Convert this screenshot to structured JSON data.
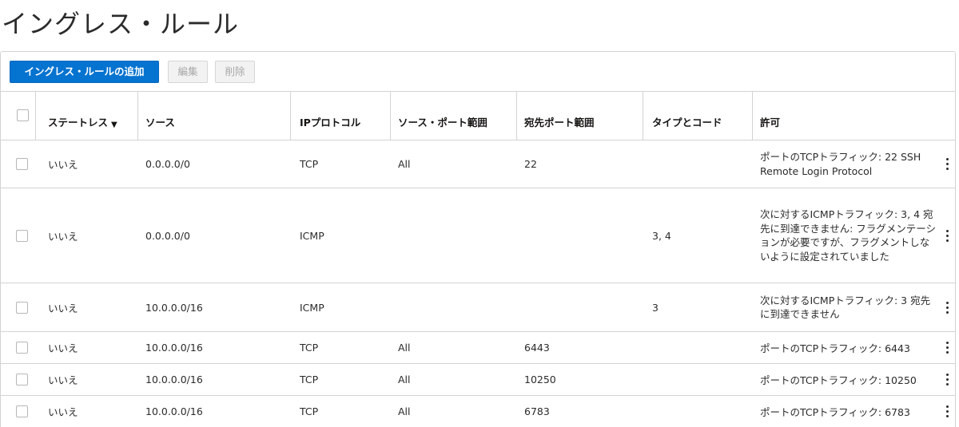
{
  "page": {
    "title": "イングレス・ルール"
  },
  "toolbar": {
    "add_label": "イングレス・ルールの追加",
    "edit_label": "編集",
    "delete_label": "削除"
  },
  "table": {
    "headers": {
      "stateless": "ステートレス",
      "stateless_sort": "▼",
      "source": "ソース",
      "protocol": "IPプロトコル",
      "source_port": "ソース・ポート範囲",
      "dest_port": "宛先ポート範囲",
      "type_code": "タイプとコード",
      "allows": "許可"
    },
    "rows": [
      {
        "stateless": "いいえ",
        "source": "0.0.0.0/0",
        "protocol": "TCP",
        "source_port": "All",
        "dest_port": "22",
        "type_code": "",
        "allows": "ポートのTCPトラフィック: 22 SSH Remote Login Protocol"
      },
      {
        "stateless": "いいえ",
        "source": "0.0.0.0/0",
        "protocol": "ICMP",
        "source_port": "",
        "dest_port": "",
        "type_code": "3, 4",
        "allows": "次に対するICMPトラフィック: 3, 4 宛先に到達できません: フラグメンテーションが必要ですが、フラグメントしないように設定されていました"
      },
      {
        "stateless": "いいえ",
        "source": "10.0.0.0/16",
        "protocol": "ICMP",
        "source_port": "",
        "dest_port": "",
        "type_code": "3",
        "allows": "次に対するICMPトラフィック: 3 宛先に到達できません"
      },
      {
        "stateless": "いいえ",
        "source": "10.0.0.0/16",
        "protocol": "TCP",
        "source_port": "All",
        "dest_port": "6443",
        "type_code": "",
        "allows": "ポートのTCPトラフィック: 6443"
      },
      {
        "stateless": "いいえ",
        "source": "10.0.0.0/16",
        "protocol": "TCP",
        "source_port": "All",
        "dest_port": "10250",
        "type_code": "",
        "allows": "ポートのTCPトラフィック: 10250"
      },
      {
        "stateless": "いいえ",
        "source": "10.0.0.0/16",
        "protocol": "TCP",
        "source_port": "All",
        "dest_port": "6783",
        "type_code": "",
        "allows": "ポートのTCPトラフィック: 6783"
      }
    ]
  },
  "icons": {
    "row_menu": "kebab-icon",
    "sort": "sort-down-icon"
  },
  "colors": {
    "primary": "#0573d0",
    "border": "#d3d3d3",
    "disabled_text": "#a8a8a8"
  }
}
